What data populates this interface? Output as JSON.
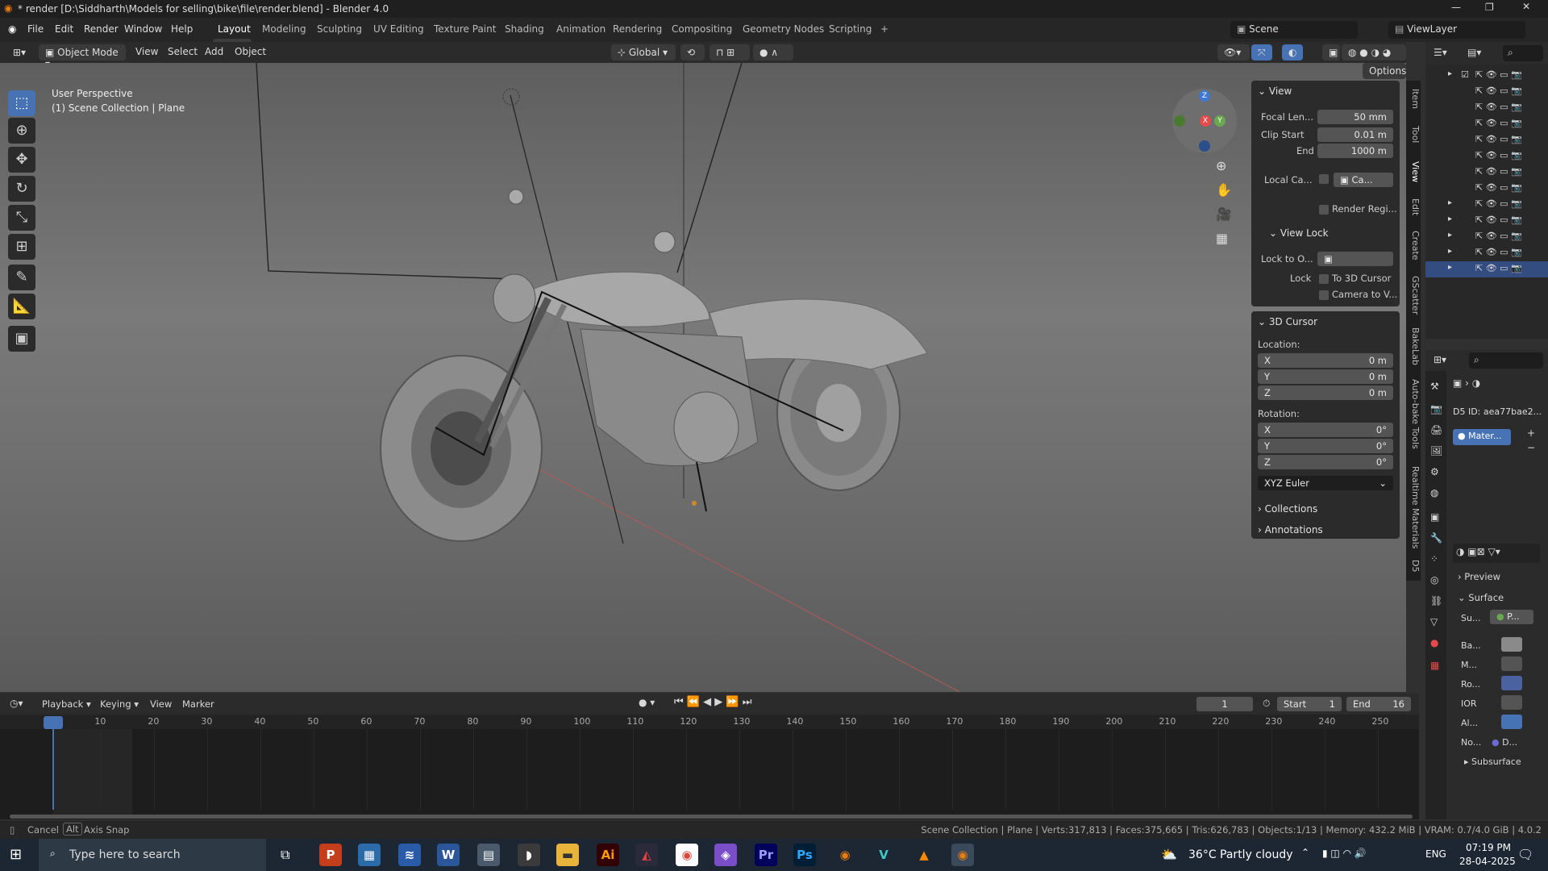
{
  "title": "* render [D:\\Siddharth\\Models for selling\\bike\\file\\render.blend] - Blender 4.0",
  "menu": [
    "File",
    "Edit",
    "Render",
    "Window",
    "Help"
  ],
  "workspaces": [
    "Layout",
    "Modeling",
    "Sculpting",
    "UV Editing",
    "Texture Paint",
    "Shading",
    "Animation",
    "Rendering",
    "Compositing",
    "Geometry Nodes",
    "Scripting"
  ],
  "scene": "Scene",
  "view_layer": "ViewLayer",
  "header": {
    "mode": "Object Mode",
    "view": "View",
    "select": "Select",
    "add": "Add",
    "object": "Object",
    "orientation": "Global",
    "options": "Options"
  },
  "viewport": {
    "line1": "User Perspective",
    "line2": "(1) Scene Collection | Plane"
  },
  "gizmo": {
    "z": "Z",
    "x": "X",
    "y": "Y"
  },
  "npanel": {
    "view_title": "View",
    "focal_label": "Focal Len...",
    "focal_value": "50 mm",
    "clip_start_label": "Clip Start",
    "clip_start_value": "0.01 m",
    "end_label": "End",
    "end_value": "1000 m",
    "local_cam_label": "Local Ca...",
    "local_cam_value": "Ca...",
    "render_region": "Render Regi...",
    "view_lock_title": "View Lock",
    "lock_to_label": "Lock to O...",
    "lock_label": "Lock",
    "to_3d_cursor": "To 3D Cursor",
    "camera_to_view": "Camera to V...",
    "cursor_title": "3D Cursor",
    "location": "Location:",
    "loc_x": "X",
    "loc_x_val": "0 m",
    "loc_y": "Y",
    "loc_y_val": "0 m",
    "loc_z": "Z",
    "loc_z_val": "0 m",
    "rotation": "Rotation:",
    "rot_x": "X",
    "rot_x_val": "0°",
    "rot_y": "Y",
    "rot_y_val": "0°",
    "rot_z": "Z",
    "rot_z_val": "0°",
    "euler": "XYZ Euler",
    "collections": "Collections",
    "annotations": "Annotations"
  },
  "side_tabs": [
    "Item",
    "Tool",
    "View",
    "Edit",
    "Create",
    "GScatter",
    "BakeLab",
    "Auto-bake Tools",
    "Realtime Materials",
    "D5"
  ],
  "props": {
    "d5_id": "D5 ID: aea77bae2...",
    "material": "Mater...",
    "preview": "Preview",
    "surface": "Surface",
    "su": "Su...",
    "su_val": "P...",
    "ba": "Ba...",
    "m": "M...",
    "ro": "Ro...",
    "ior": "IOR",
    "al": "Al...",
    "no": "No...",
    "no_val": "D...",
    "subsurface": "Subsurface"
  },
  "timeline": {
    "playback": "Playback",
    "keying": "Keying",
    "view": "View",
    "marker": "Marker",
    "current": "1",
    "start_label": "Start",
    "start": "1",
    "end_label": "End",
    "end": "16",
    "ticks": [
      "1",
      "10",
      "20",
      "30",
      "40",
      "50",
      "60",
      "70",
      "80",
      "90",
      "100",
      "110",
      "120",
      "130",
      "140",
      "150",
      "160",
      "170",
      "180",
      "190",
      "200",
      "210",
      "220",
      "230",
      "240",
      "250"
    ]
  },
  "status": {
    "cancel": "Cancel",
    "alt": "Alt",
    "axis_snap": "Axis Snap",
    "info": "Scene Collection | Plane | Verts:317,813 | Faces:375,665 | Tris:626,783 | Objects:1/13 | Memory: 432.2 MiB | VRAM: 0.7/4.0 GiB | 4.0.2"
  },
  "taskbar": {
    "search": "Type here to search",
    "weather": "36°C  Partly cloudy",
    "lang": "ENG",
    "time": "07:19 PM",
    "date": "28-04-2025"
  },
  "colors": {
    "accent": "#4772b3",
    "gizmo_x": "#e64a4a",
    "gizmo_y": "#6aa84f",
    "gizmo_z": "#3e78d1"
  }
}
